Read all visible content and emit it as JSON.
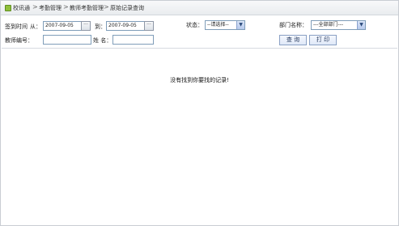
{
  "breadcrumb": {
    "items": [
      "校讯通",
      "考勤管理",
      "教师考勤管理",
      "原始记录查询"
    ],
    "separator": ">"
  },
  "filters": {
    "signin_time_label": "签到时间",
    "from_label": "从：",
    "start_date": "2007-09-05",
    "to_label": "到：",
    "end_date": "2007-09-05",
    "picker_icon": "···",
    "status_label": "状态：",
    "status_selected": "--请选择--",
    "department_label": "部门名称：",
    "department_selected": "---全部部门---",
    "teacher_id_label": "教师编号：",
    "teacher_id_value": "",
    "name_label": "姓 名：",
    "name_value": ""
  },
  "actions": {
    "query_label": "查 询",
    "print_label": "打 印"
  },
  "results": {
    "empty_message": "没有找到你要找的记录!"
  },
  "colors": {
    "border": "#7f9db9",
    "button_text": "#1f3358",
    "breadcrumb_icon": "#8fbf3b"
  },
  "icons": {
    "breadcrumb": "home-icon",
    "date_picker": "calendar-icon",
    "dropdown": "chevron-down-icon"
  }
}
